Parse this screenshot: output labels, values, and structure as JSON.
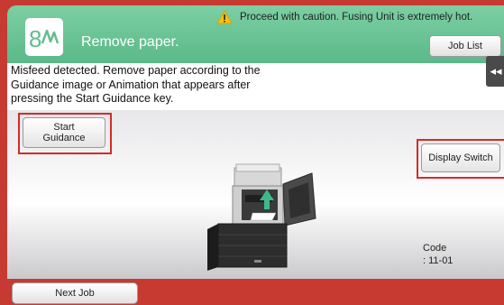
{
  "header": {
    "title": "Remove paper.",
    "warning": "Proceed with caution. Fusing Unit is extremely hot.",
    "job_list_label": "Job List",
    "logo_icon": "paper-misfeed-icon",
    "warning_icon": "warning-triangle-icon",
    "accent_color": "#62bd8f"
  },
  "message": {
    "text": "Misfeed detected. Remove paper according to the Guidance image or Animation that appears after pressing the Start Guidance key."
  },
  "side_tab": {
    "label": "◂◂",
    "icon": "collapse-left-icon"
  },
  "main": {
    "start_guidance_label": "Start\nGuidance",
    "display_switch_label": "Display Switch",
    "code_label": "Code",
    "code_value": ": 11-01",
    "illustration": "printer-open-door-illustration"
  },
  "footer": {
    "next_job_label": "Next Job"
  },
  "colors": {
    "footer": "#c63a32",
    "highlight": "#d62a2a"
  }
}
